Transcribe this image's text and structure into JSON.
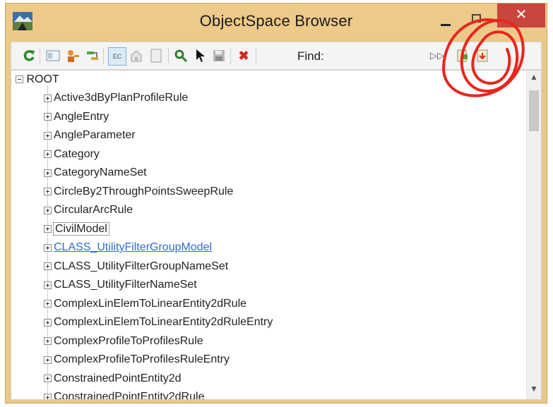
{
  "window": {
    "title": "ObjectSpace Browser",
    "close_label": "✕"
  },
  "toolbar": {
    "find_label": "Find:",
    "find_value": "",
    "buttons": [
      "refresh-icon",
      "panel-icon",
      "key-person-icon",
      "connect-icon",
      "ec-icon",
      "ec-home-icon",
      "page-icon",
      "search-person-icon",
      "pointer-icon",
      "save-icon",
      "delete-icon",
      "fast-forward-icon",
      "export-icon",
      "import-icon"
    ]
  },
  "tree": {
    "root_label": "ROOT",
    "items": [
      "Active3dByPlanProfileRule",
      "AngleEntry",
      "AngleParameter",
      "Category",
      "CategoryNameSet",
      "CircleBy2ThroughPointsSweepRule",
      "CircularArcRule",
      "CivilModel",
      "CLASS_UtilityFilterGroupModel",
      "CLASS_UtilityFilterGroupNameSet",
      "CLASS_UtilityFilterNameSet",
      "ComplexLinElemToLinearEntity2dRule",
      "ComplexLinElemToLinearEntity2dRuleEntry",
      "ComplexProfileToProfilesRule",
      "ComplexProfileToProfilesRuleEntry",
      "ConstrainedPointEntity2d",
      "ConstrainedPointEntity2dRule"
    ],
    "focused_index": 7,
    "hover_index": 8
  },
  "colors": {
    "titlebar": "#edc98a",
    "close_button": "#c9463f",
    "annotation": "#e8261d",
    "link": "#2f6bd1"
  }
}
